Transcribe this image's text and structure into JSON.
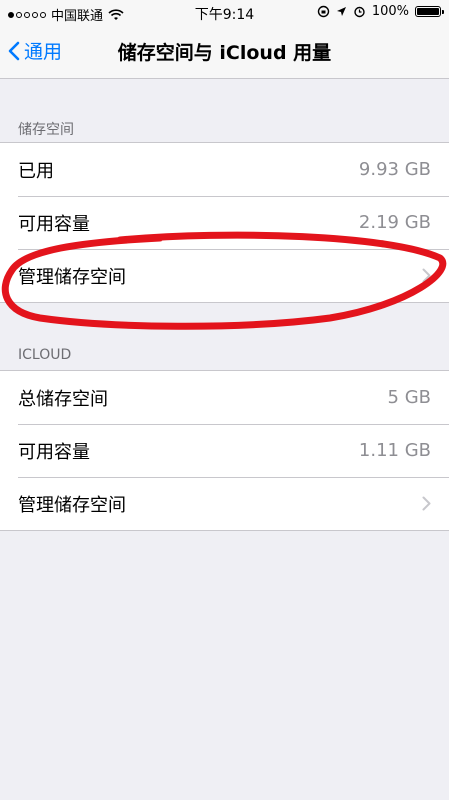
{
  "status_bar": {
    "carrier": "中国联通",
    "time": "下午9:14",
    "battery": "100%"
  },
  "nav": {
    "back_label": "通用",
    "title": "储存空间与 iCloud 用量"
  },
  "storage_section": {
    "header": "储存空间",
    "rows": [
      {
        "label": "已用",
        "value": "9.93 GB"
      },
      {
        "label": "可用容量",
        "value": "2.19 GB"
      },
      {
        "label": "管理储存空间"
      }
    ]
  },
  "icloud_section": {
    "header": "ICLOUD",
    "rows": [
      {
        "label": "总储存空间",
        "value": "5 GB"
      },
      {
        "label": "可用容量",
        "value": "1.11 GB"
      },
      {
        "label": "管理储存空间"
      }
    ]
  },
  "annotation": {
    "color": "#e3141c"
  },
  "colors": {
    "accent": "#007aff",
    "background": "#efeff4",
    "secondary_text": "#8e8e93"
  }
}
